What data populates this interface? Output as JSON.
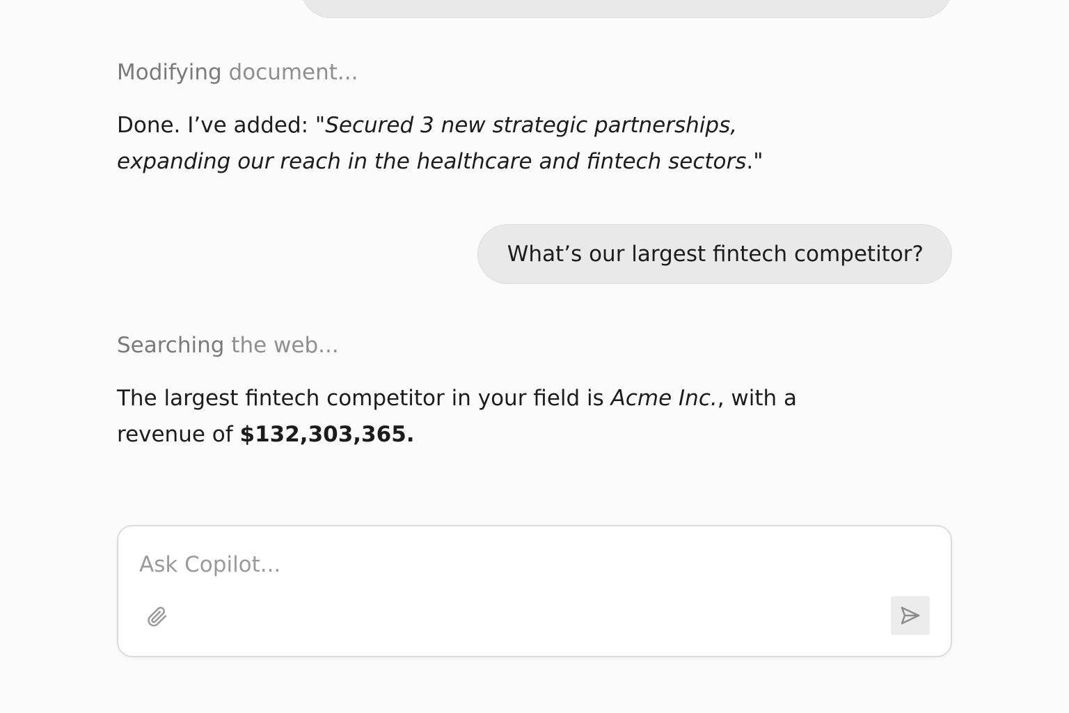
{
  "conversation": {
    "status_1_a": "Modifying",
    "status_1_b": " document...",
    "reply_1": {
      "prefix": "Done. I’ve added: \"",
      "italic": "Secured 3 new strategic partnerships, expanding our reach in the healthcare and fintech sectors",
      "suffix": ".\""
    },
    "user_question": "What’s our largest fintech competitor?",
    "status_2_a": "Searching",
    "status_2_b": " the web...",
    "reply_2": {
      "prefix": "The largest fintech competitor in your field is ",
      "italic": "Acme Inc.",
      "middle": ", with a revenue of ",
      "bold": "$132,303,365."
    }
  },
  "composer": {
    "placeholder": "Ask Copilot...",
    "attach_icon": "paperclip-icon",
    "send_icon": "send-icon"
  },
  "colors": {
    "background": "#fbfbfb",
    "bubble": "#e9e9e9",
    "status_text": "#8f8f8f"
  }
}
